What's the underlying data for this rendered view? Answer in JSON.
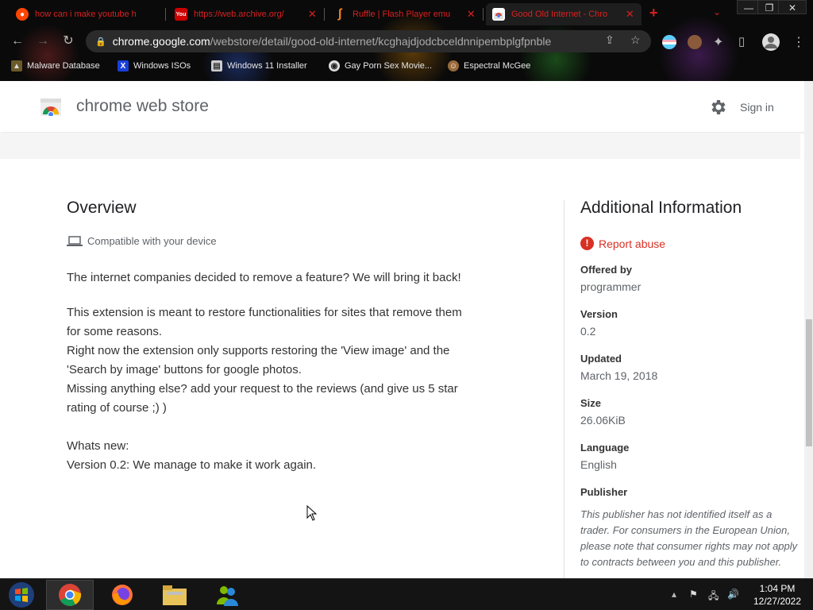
{
  "tabs": [
    {
      "title": "how can i make youtube h",
      "favicon": "reddit-icon",
      "color": "#ff4500"
    },
    {
      "title": "https://web.archive.org/",
      "favicon": "youtube-icon",
      "color": "#ff0000"
    },
    {
      "title": "Ruffle | Flash Player emu",
      "favicon": "ruffle-icon",
      "color": "#f58220"
    },
    {
      "title": "Good Old Internet - Chro",
      "favicon": "webstore-icon",
      "color": "#d92020"
    }
  ],
  "toolbar": {
    "url_host": "chrome.google.com",
    "url_path": "/webstore/detail/good-old-internet/kcghajdjodcbceldnnipembplgfpnble"
  },
  "bookmarks": [
    {
      "label": "Malware Database",
      "icon": "folder-icon"
    },
    {
      "label": "Windows ISOs",
      "icon": "x-icon"
    },
    {
      "label": "Windows 11 Installer",
      "icon": "page-icon"
    },
    {
      "label": "Gay Porn Sex Movie...",
      "icon": "globe-icon"
    },
    {
      "label": "Espectral McGee",
      "icon": "avatar-icon"
    }
  ],
  "store": {
    "title": "chrome web store",
    "signin": "Sign in"
  },
  "overview": {
    "heading": "Overview",
    "compat": "Compatible with your device",
    "paragraphs": [
      "The internet companies decided to remove a feature? We will bring it back!",
      "This extension is meant to restore functionalities for sites that remove them\nfor some reasons.\nRight now the extension only supports restoring the 'View image' and the\n'Search by image' buttons for google photos.\nMissing anything else? add your request to the reviews (and give us 5 star\nrating of course ;) )",
      "Whats new:\nVersion 0.2: We manage to make it work again."
    ]
  },
  "additional": {
    "heading": "Additional Information",
    "report": "Report abuse",
    "offered_by_label": "Offered by",
    "offered_by": "programmer",
    "version_label": "Version",
    "version": "0.2",
    "updated_label": "Updated",
    "updated": "March 19, 2018",
    "size_label": "Size",
    "size": "26.06KiB",
    "language_label": "Language",
    "language": "English",
    "publisher_label": "Publisher",
    "publisher_note": "This publisher has not identified itself as a trader. For consumers in the European Union, please note that consumer rights may not apply to contracts between you and this publisher."
  },
  "taskbar": {
    "time": "1:04 PM",
    "date": "12/27/2022"
  },
  "colors": {
    "tab_text": "#d92020",
    "report": "#d93025",
    "accent_blue": "#1a73e8"
  }
}
